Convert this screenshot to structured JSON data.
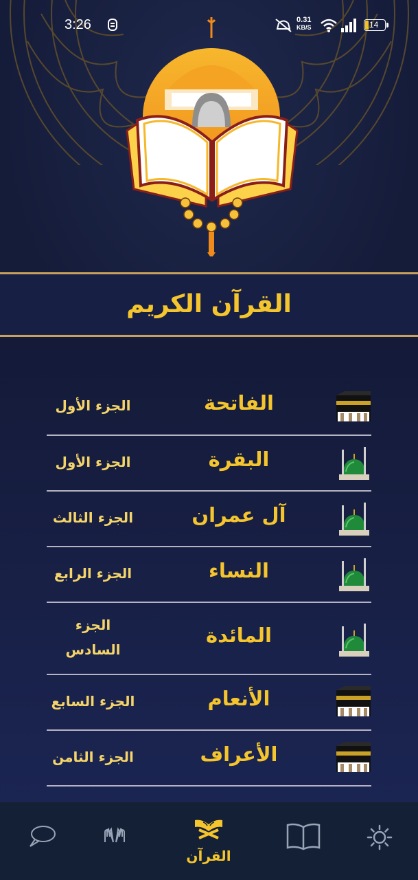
{
  "status": {
    "time": "3:26",
    "speed_value": "0.31",
    "speed_unit": "KB/S",
    "battery": "14"
  },
  "header": {
    "title": "القرآن الكريم"
  },
  "surahs": [
    {
      "name": "الفاتحة",
      "part": "الجزء الأول",
      "icon": "kaaba-icon"
    },
    {
      "name": "البقرة",
      "part": "الجزء الأول",
      "icon": "mosque-dome-icon"
    },
    {
      "name": "آل عمران",
      "part": "الجزء الثالث",
      "icon": "mosque-dome-icon"
    },
    {
      "name": "النساء",
      "part": "الجزء الرابع",
      "icon": "mosque-dome-icon"
    },
    {
      "name": "المائدة",
      "part_line1": "الجزء",
      "part_line2": "السادس",
      "icon": "mosque-dome-icon"
    },
    {
      "name": "الأنعام",
      "part": "الجزء السابع",
      "icon": "kaaba-icon"
    },
    {
      "name": "الأعراف",
      "part": "الجزء الثامن",
      "icon": "kaaba-icon"
    }
  ],
  "nav": {
    "items": [
      {
        "icon": "chat-bubble-icon"
      },
      {
        "icon": "praying-hands-icon"
      },
      {
        "icon": "quran-icon",
        "label": "القرآن",
        "active": true
      },
      {
        "icon": "open-book-icon"
      },
      {
        "icon": "settings-icon"
      }
    ]
  },
  "colors": {
    "background": "#151c3a",
    "accent_gold": "#f5c52e",
    "divider": "#b6b3c4",
    "nav_background": "#142035"
  }
}
